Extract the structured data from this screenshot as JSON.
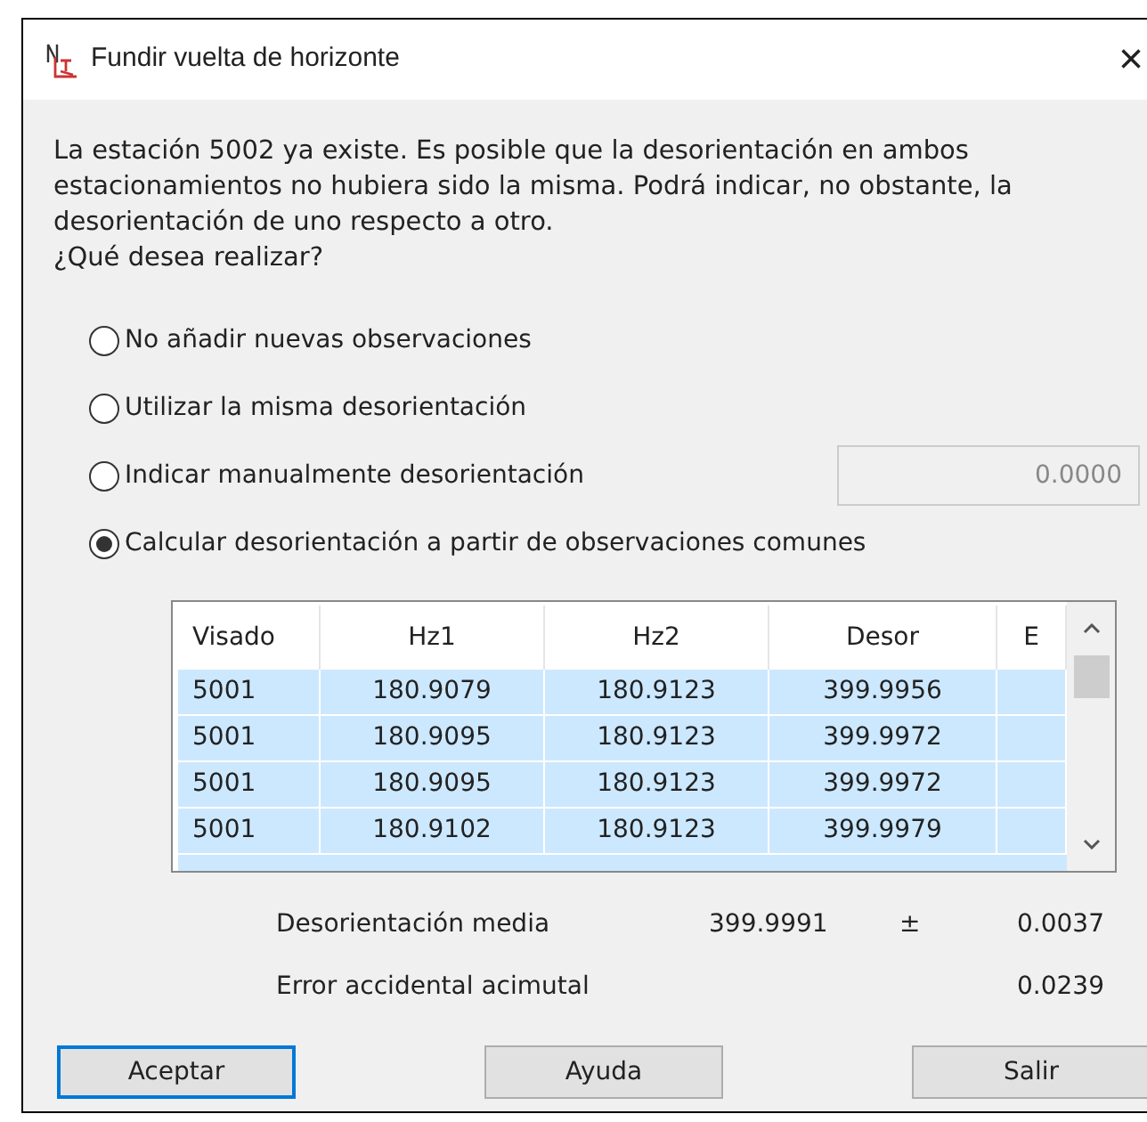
{
  "window": {
    "title": "Fundir vuelta de horizonte",
    "close": "×"
  },
  "message": "La estación 5002 ya existe. Es posible que la desorientación en ambos estacionamientos no hubiera sido la misma. Podrá indicar, no obstante, la desorientación de uno respecto a otro.\n¿Qué desea realizar?",
  "options": [
    {
      "label": "No añadir nuevas observaciones",
      "selected": false
    },
    {
      "label": "Utilizar la misma desorientación",
      "selected": false
    },
    {
      "label": "Indicar manualmente desorientación",
      "selected": false,
      "field": {
        "value": "0.0000",
        "disabled": true
      }
    },
    {
      "label": "Calcular desorientación a partir de observaciones comunes",
      "selected": true
    }
  ],
  "table": {
    "columns": [
      "Visado",
      "Hz1",
      "Hz2",
      "Desor",
      "E"
    ],
    "rows": [
      {
        "cells": [
          "5001",
          "180.9079",
          "180.9123",
          "399.9956",
          ""
        ],
        "selected": true
      },
      {
        "cells": [
          "5001",
          "180.9095",
          "180.9123",
          "399.9972",
          ""
        ],
        "selected": true
      },
      {
        "cells": [
          "5001",
          "180.9095",
          "180.9123",
          "399.9972",
          ""
        ],
        "selected": true
      },
      {
        "cells": [
          "5001",
          "180.9102",
          "180.9123",
          "399.9979",
          ""
        ],
        "selected": true
      }
    ]
  },
  "summary": [
    {
      "label": "Desorientación media",
      "value": "399.9991",
      "sign": "±",
      "error": "0.0037"
    },
    {
      "label": "Error accidental acimutal",
      "error": "0.0239"
    }
  ],
  "buttons": [
    {
      "label": "Aceptar",
      "default": true
    },
    {
      "label": "Ayuda",
      "default": false
    },
    {
      "label": "Salir",
      "default": false
    }
  ]
}
